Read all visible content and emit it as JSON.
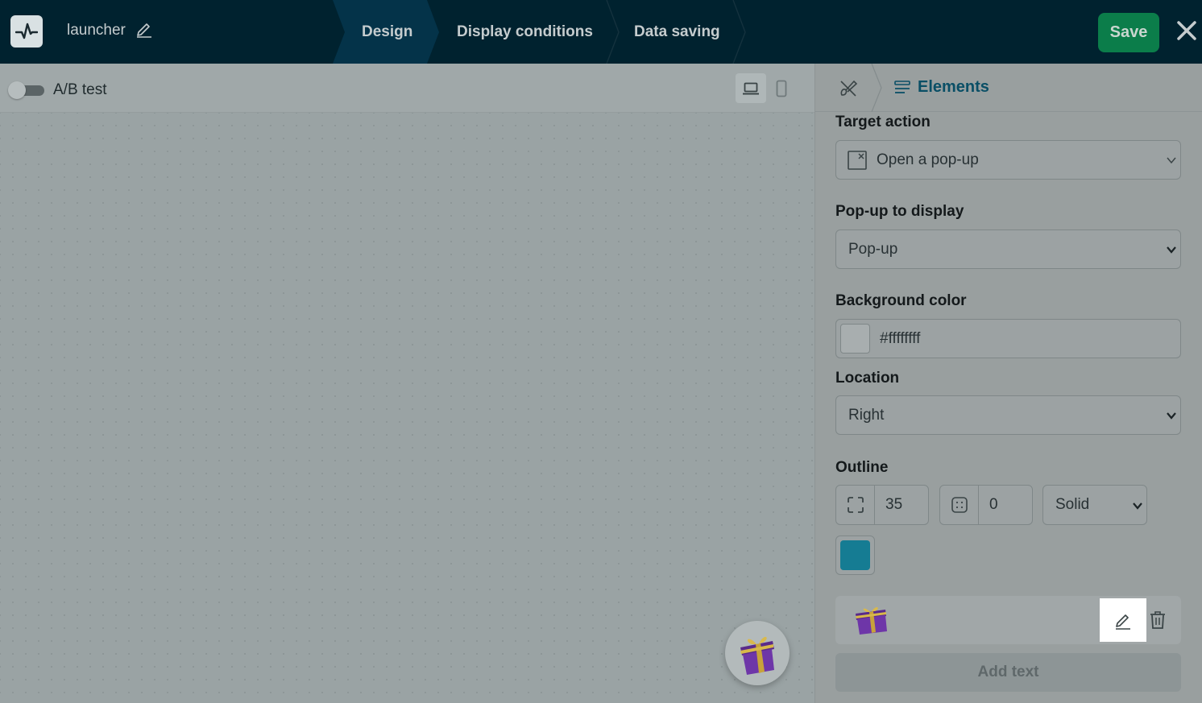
{
  "header": {
    "title": "launcher",
    "steps": [
      "Design",
      "Display conditions",
      "Data saving"
    ],
    "active_step": "Design",
    "save_label": "Save"
  },
  "toolbar": {
    "ab_test_label": "A/B test",
    "ab_test_enabled": false,
    "device_active": "desktop"
  },
  "panel": {
    "tab_label": "Elements",
    "target_action": {
      "label": "Target action",
      "value": "Open a pop-up"
    },
    "popup": {
      "label": "Pop-up to display",
      "value": "Pop-up"
    },
    "background": {
      "label": "Background color",
      "value": "#ffffffff"
    },
    "location": {
      "label": "Location",
      "value": "Right"
    },
    "outline": {
      "label": "Outline",
      "radius": "35",
      "width": "0",
      "style": "Solid",
      "color": "#157c93"
    },
    "add_text_label": "Add text"
  },
  "colors": {
    "header_bg": "#00222f",
    "save_bg": "#0b7d4a",
    "accent": "#0a4f66",
    "outline_color": "#157c93"
  }
}
